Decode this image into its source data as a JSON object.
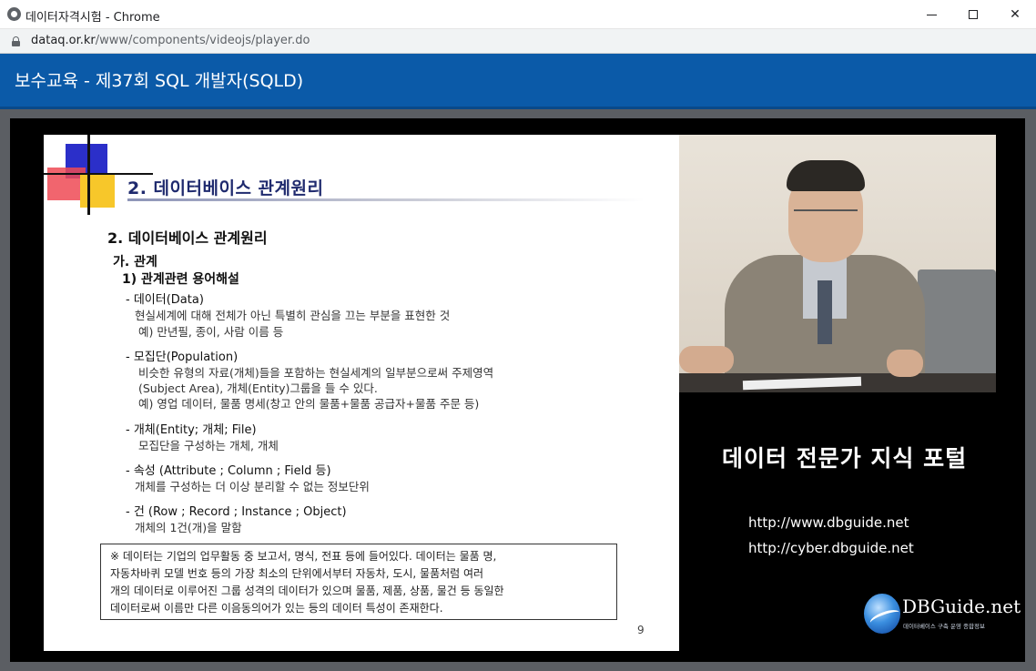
{
  "window": {
    "title": "데이터자격시험 - Chrome",
    "url_host": "dataq.or.kr",
    "url_path": "/www/components/videojs/player.do"
  },
  "header": {
    "course_title": "보수교육 - 제37회 SQL 개발자(SQLD)"
  },
  "slide": {
    "heading": "2. 데이터베이스 관계원리",
    "subtitle": "2. 데이터베이스 관계원리",
    "section": "가. 관계",
    "subsection": "1) 관계관련 용어해설",
    "items": [
      {
        "term": "- 데이터(Data)",
        "lines": [
          "현실세계에 대해 전체가 아닌 특별히 관심을 끄는 부분을 표현한 것",
          "예) 만년필, 종이, 사람 이름 등"
        ]
      },
      {
        "term": "- 모집단(Population)",
        "lines": [
          "비슷한 유형의 자료(개체)들을 포함하는 현실세계의 일부분으로써 주제영역",
          "(Subject Area), 개체(Entity)그룹을 들 수 있다.",
          "예) 영업 데이터, 물품 명세(창고 안의 물품+물품 공급자+물품 주문 등)"
        ]
      },
      {
        "term": "- 개체(Entity; 개체; File)",
        "lines": [
          "모집단을 구성하는 개체, 개체"
        ]
      },
      {
        "term": "- 속성 (Attribute ; Column ; Field 등)",
        "lines": [
          "개체를 구성하는 더 이상 분리할 수 없는 정보단위"
        ]
      },
      {
        "term": "- 건 (Row ; Record ; Instance ; Object)",
        "lines": [
          "개체의 1건(개)을 말함"
        ]
      }
    ],
    "note_lines": [
      "※ 데이터는 기업의 업무활동 중 보고서, 명식, 전표 등에 들어있다. 데이터는 물품 명,",
      "   자동차바퀴 모델 번호 등의 가장 최소의 단위에서부터 자동차, 도시, 물품처럼 여러",
      "   개의 데이터로 이루어진 그룹 성격의 데이터가 있으며 물품, 제품, 상품, 물건 등 동일한",
      "   데이터로써 이름만 다른 이음동의어가 있는 등의 데이터 특성이 존재한다."
    ],
    "page_number": "9"
  },
  "side": {
    "portal_title": "데이터 전문가 지식 포털",
    "link1": "http://www.dbguide.net",
    "link2": "http://cyber.dbguide.net",
    "logo_text": "DBGuide.net",
    "logo_tagline": "데이터베이스 구축 운영 종합정보"
  }
}
